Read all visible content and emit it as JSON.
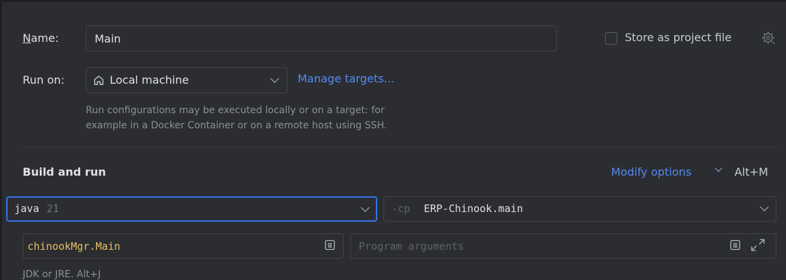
{
  "name_row": {
    "label_prefix": "N",
    "label_rest": "ame:",
    "value": "Main",
    "store_label": "Store as project file",
    "store_checked": false
  },
  "run_on": {
    "label": "Run on:",
    "target": "Local machine",
    "manage_link": "Manage targets...",
    "hint_line1": "Run configurations may be executed locally or on a target: for",
    "hint_line2": "example in a Docker Container or on a remote host using SSH."
  },
  "build": {
    "title": "Build and run",
    "modify_options": "Modify options",
    "modify_shortcut": "Alt+M",
    "jdk_name": "java",
    "jdk_version": "21",
    "cp_flag": "-cp",
    "cp_value": "ERP-Chinook.main",
    "main_class": "chinookMgr.Main",
    "args_placeholder": "Program arguments",
    "jdk_hint": "JDK or JRE. Alt+J"
  },
  "colors": {
    "accent": "#3574f0",
    "link": "#548af7",
    "main_class": "#e8bf6a"
  }
}
